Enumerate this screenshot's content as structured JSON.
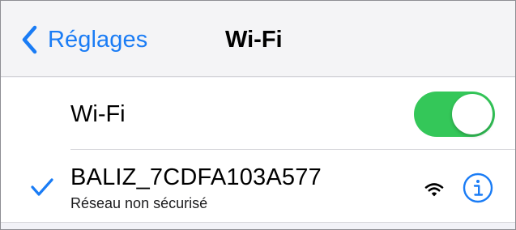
{
  "navbar": {
    "back_label": "Réglages",
    "title": "Wi-Fi"
  },
  "wifi_row": {
    "label": "Wi-Fi",
    "toggle_on": true
  },
  "network": {
    "name": "BALIZ_7CDFA103A577",
    "subtitle": "Réseau non sécurisé",
    "connected": true
  },
  "icons": {
    "back": "chevron-left-icon",
    "check": "checkmark-icon",
    "signal": "wifi-signal-icon",
    "info": "info-icon"
  },
  "colors": {
    "accent": "#1a7cf5",
    "toggle_on": "#34c759",
    "background": "#f2f2f7"
  }
}
